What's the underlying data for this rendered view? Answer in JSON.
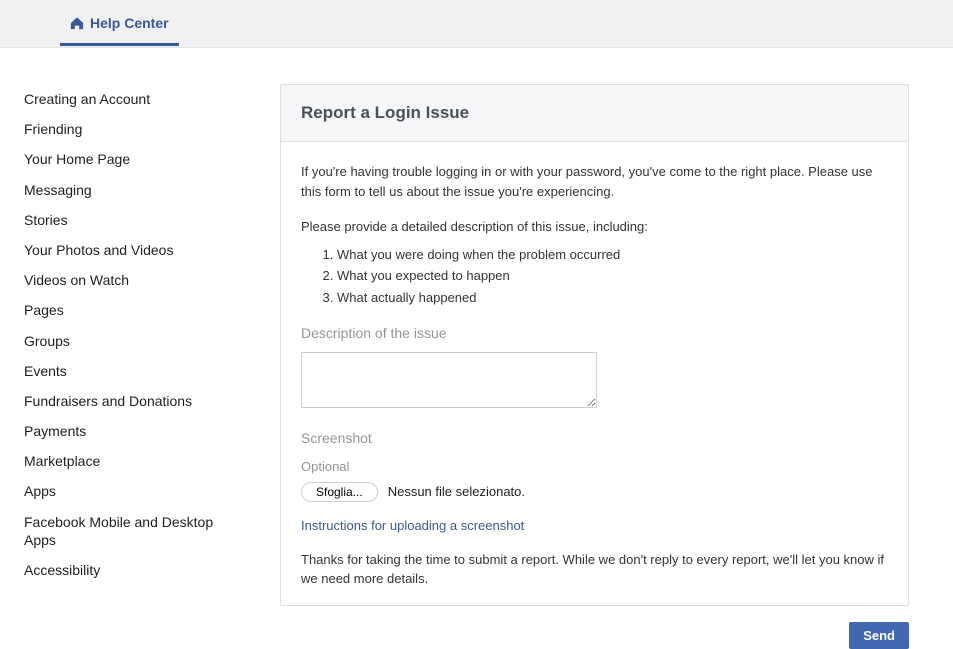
{
  "header": {
    "help_center_label": "Help Center"
  },
  "sidebar": {
    "items": [
      {
        "label": "Creating an Account"
      },
      {
        "label": "Friending"
      },
      {
        "label": "Your Home Page"
      },
      {
        "label": "Messaging"
      },
      {
        "label": "Stories"
      },
      {
        "label": "Your Photos and Videos"
      },
      {
        "label": "Videos on Watch"
      },
      {
        "label": "Pages"
      },
      {
        "label": "Groups"
      },
      {
        "label": "Events"
      },
      {
        "label": "Fundraisers and Donations"
      },
      {
        "label": "Payments"
      },
      {
        "label": "Marketplace"
      },
      {
        "label": "Apps"
      },
      {
        "label": "Facebook Mobile and Desktop Apps"
      },
      {
        "label": "Accessibility"
      }
    ]
  },
  "main": {
    "title": "Report a Login Issue",
    "intro": "If you're having trouble logging in or with your password, you've come to the right place. Please use this form to tell us about the issue you're experiencing.",
    "prompt": "Please provide a detailed description of this issue, including:",
    "steps": [
      "What you were doing when the problem occurred",
      "What you expected to happen",
      "What actually happened"
    ],
    "description_label": "Description of the issue",
    "screenshot_label": "Screenshot",
    "optional_label": "Optional",
    "browse_label": "Sfoglia...",
    "no_file_text": "Nessun file selezionato.",
    "instructions_link": "Instructions for uploading a screenshot",
    "thanks_text": "Thanks for taking the time to submit a report. While we don't reply to every report, we'll let you know if we need more details.",
    "send_label": "Send"
  }
}
